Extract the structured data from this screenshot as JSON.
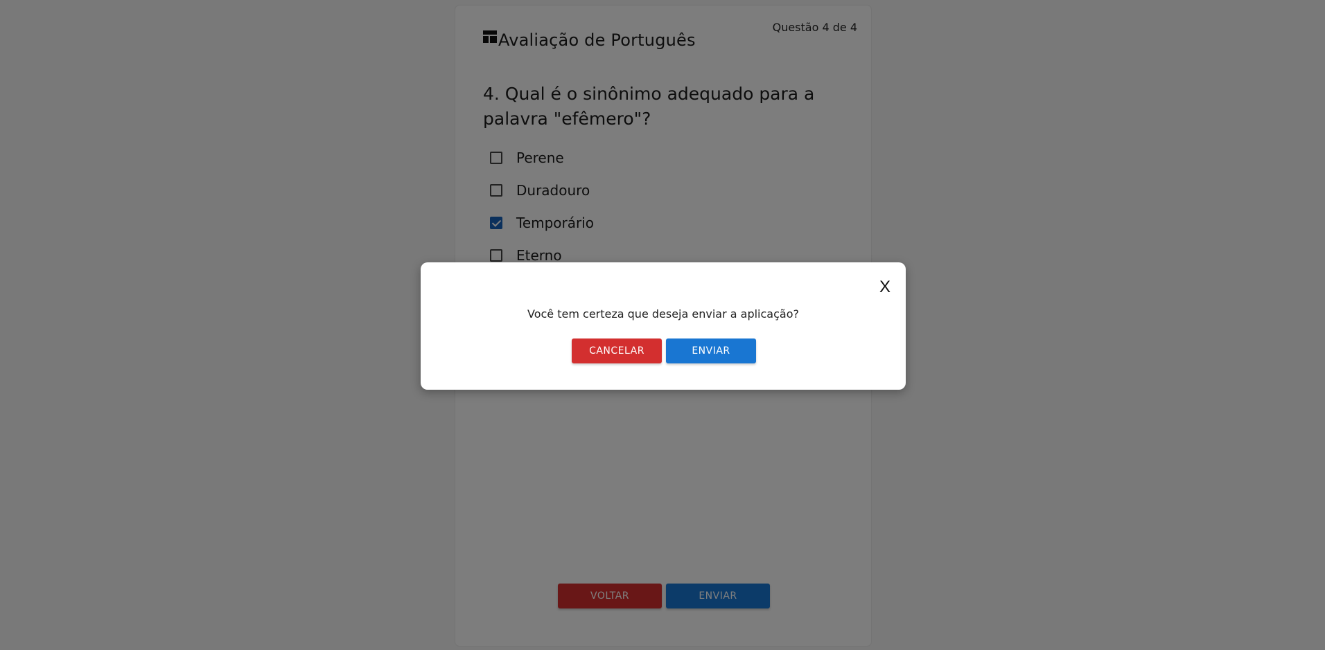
{
  "header": {
    "title": "Avaliação de Português",
    "question_counter": "Questão 4 de 4",
    "title_icon": "dashboard-icon"
  },
  "question": {
    "text": "4. Qual é o sinônimo adequado para a palavra \"efêmero\"?",
    "options": [
      {
        "label": "Perene",
        "checked": false
      },
      {
        "label": "Duradouro",
        "checked": false
      },
      {
        "label": "Temporário",
        "checked": true
      },
      {
        "label": "Eterno",
        "checked": false
      }
    ]
  },
  "footer": {
    "back_label": "VOLTAR",
    "send_label": "ENVIAR"
  },
  "modal": {
    "close_label": "X",
    "message": "Você tem certeza que deseja enviar a aplicação?",
    "cancel_label": "CANCELAR",
    "confirm_label": "ENVIAR"
  },
  "colors": {
    "danger": "#d32f2f",
    "primary": "#1976d2",
    "checkbox_checked": "#1660b8"
  }
}
